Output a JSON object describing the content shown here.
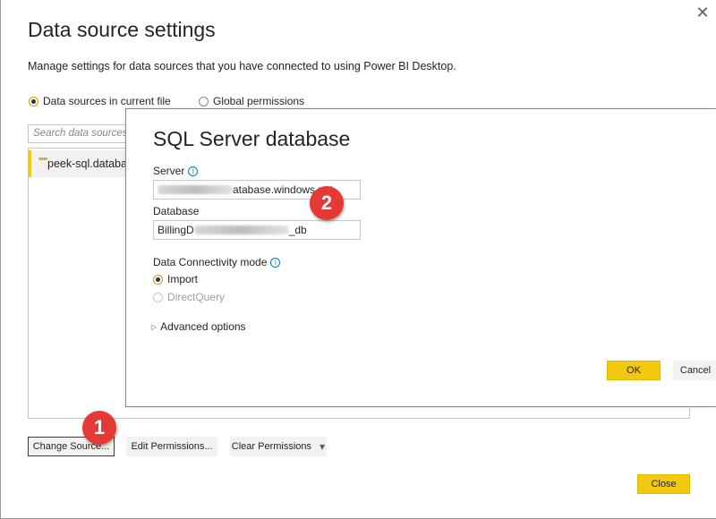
{
  "window": {
    "title": "Data source settings",
    "subtitle": "Manage settings for data sources that you have connected to using Power BI Desktop."
  },
  "scope": {
    "current_file": "Data sources in current file",
    "global": "Global permissions"
  },
  "search": {
    "placeholder": "Search data sources"
  },
  "list": {
    "items": [
      {
        "label": "peek-sql.database.windows.net"
      }
    ]
  },
  "buttons": {
    "change_source": "Change Source...",
    "edit_permissions": "Edit Permissions...",
    "clear_permissions": "Clear Permissions",
    "close": "Close"
  },
  "dialog": {
    "title": "SQL Server database",
    "server_label": "Server",
    "server_value_visible": "atabase.windows.net",
    "database_label": "Database",
    "database_prefix": "BillingD",
    "database_suffix": "_db",
    "connectivity_label": "Data Connectivity mode",
    "import_label": "Import",
    "directquery_label": "DirectQuery",
    "advanced_label": "Advanced options",
    "ok": "OK",
    "cancel": "Cancel"
  },
  "annotations": {
    "badge1": "1",
    "badge2": "2"
  },
  "colors": {
    "accent": "#f2c811",
    "badge": "#e53935",
    "info": "#0078d4"
  }
}
